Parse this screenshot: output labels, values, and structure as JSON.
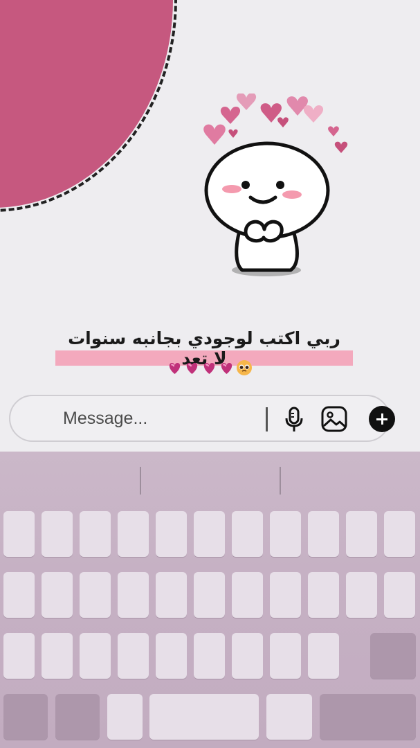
{
  "caption": "ربي اكتب لوجودي بجانبه سنوات لا تعد",
  "composer": {
    "placeholder": "Message..."
  },
  "icons": {
    "mic": "microphone-icon",
    "gallery": "gallery-icon",
    "plus": "plus-icon",
    "emoji_hearts": "revolving-hearts-icon",
    "emoji_face": "pleading-face-icon"
  },
  "colors": {
    "accent_pink": "#c6587f",
    "caption_highlight": "#f3a9bd",
    "keyboard_bg": "#c6b1c4",
    "key_bg": "#e7dfe8"
  }
}
